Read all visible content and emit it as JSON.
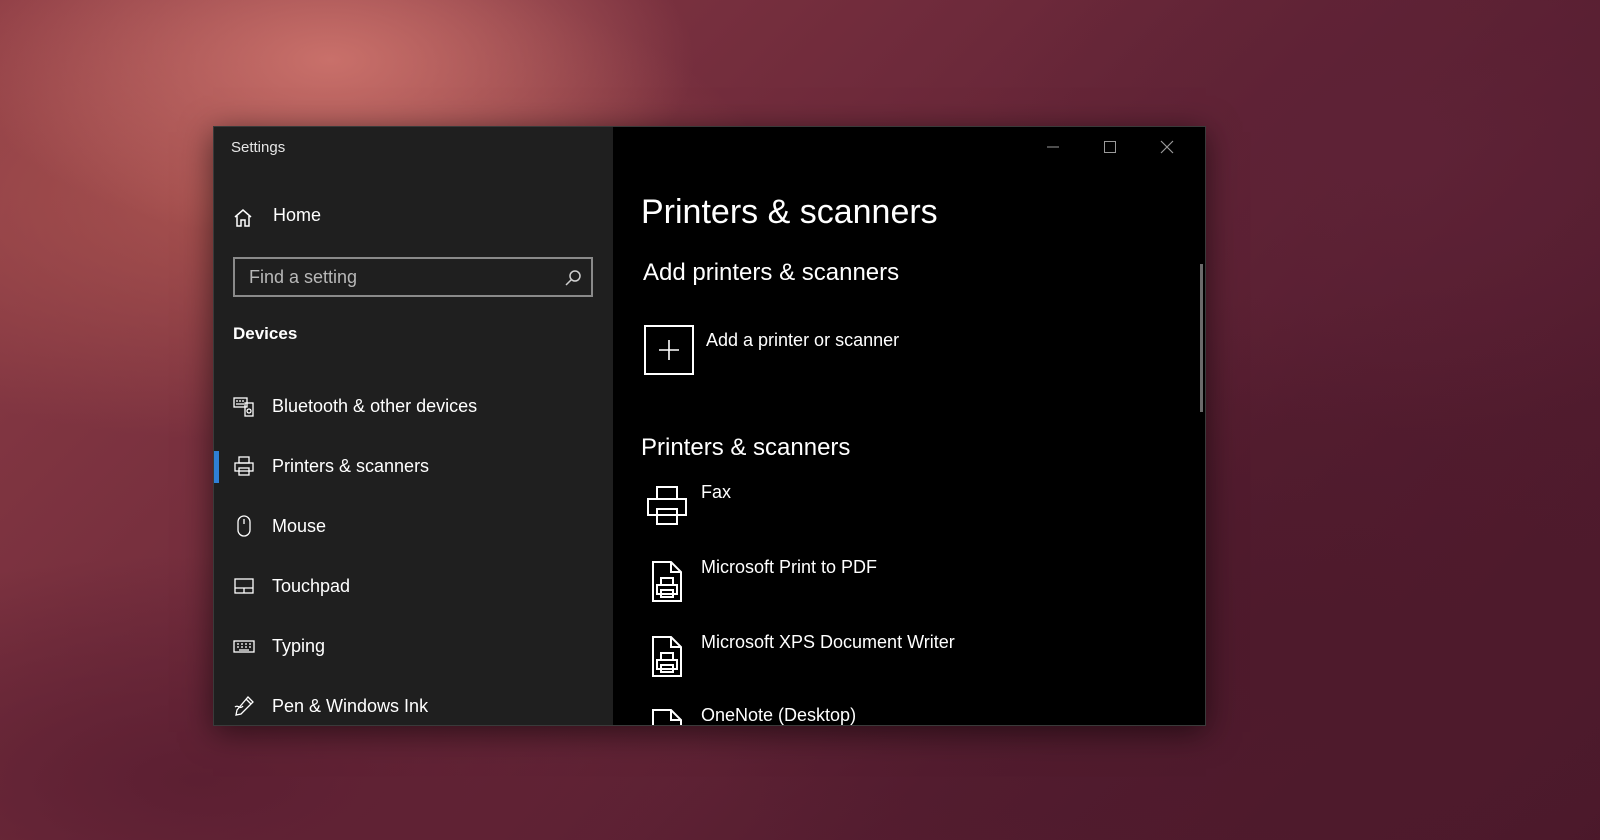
{
  "window": {
    "title": "Settings",
    "controls": {
      "minimize_icon": "minimize-icon",
      "maximize_icon": "maximize-icon",
      "close_icon": "close-icon"
    }
  },
  "sidebar": {
    "home_label": "Home",
    "search_placeholder": "Find a setting",
    "section": "Devices",
    "items": [
      {
        "label": "Bluetooth & other devices",
        "icon": "bluetooth-devices-icon",
        "active": false
      },
      {
        "label": "Printers & scanners",
        "icon": "printer-icon",
        "active": true
      },
      {
        "label": "Mouse",
        "icon": "mouse-icon",
        "active": false
      },
      {
        "label": "Touchpad",
        "icon": "touchpad-icon",
        "active": false
      },
      {
        "label": "Typing",
        "icon": "keyboard-icon",
        "active": false
      },
      {
        "label": "Pen & Windows Ink",
        "icon": "pen-icon",
        "active": false
      }
    ]
  },
  "main": {
    "title": "Printers & scanners",
    "add_section": "Add printers & scanners",
    "add_label": "Add a printer or scanner",
    "list_section": "Printers & scanners",
    "printers": [
      {
        "name": "Fax",
        "icon": "printer-icon"
      },
      {
        "name": "Microsoft Print to PDF",
        "icon": "document-printer-icon"
      },
      {
        "name": "Microsoft XPS Document Writer",
        "icon": "document-printer-icon"
      },
      {
        "name": "OneNote (Desktop)",
        "icon": "document-printer-icon"
      }
    ]
  },
  "colors": {
    "accent": "#2f7fd6",
    "sidebar_bg": "#1f1f1f",
    "main_bg": "#000000"
  }
}
